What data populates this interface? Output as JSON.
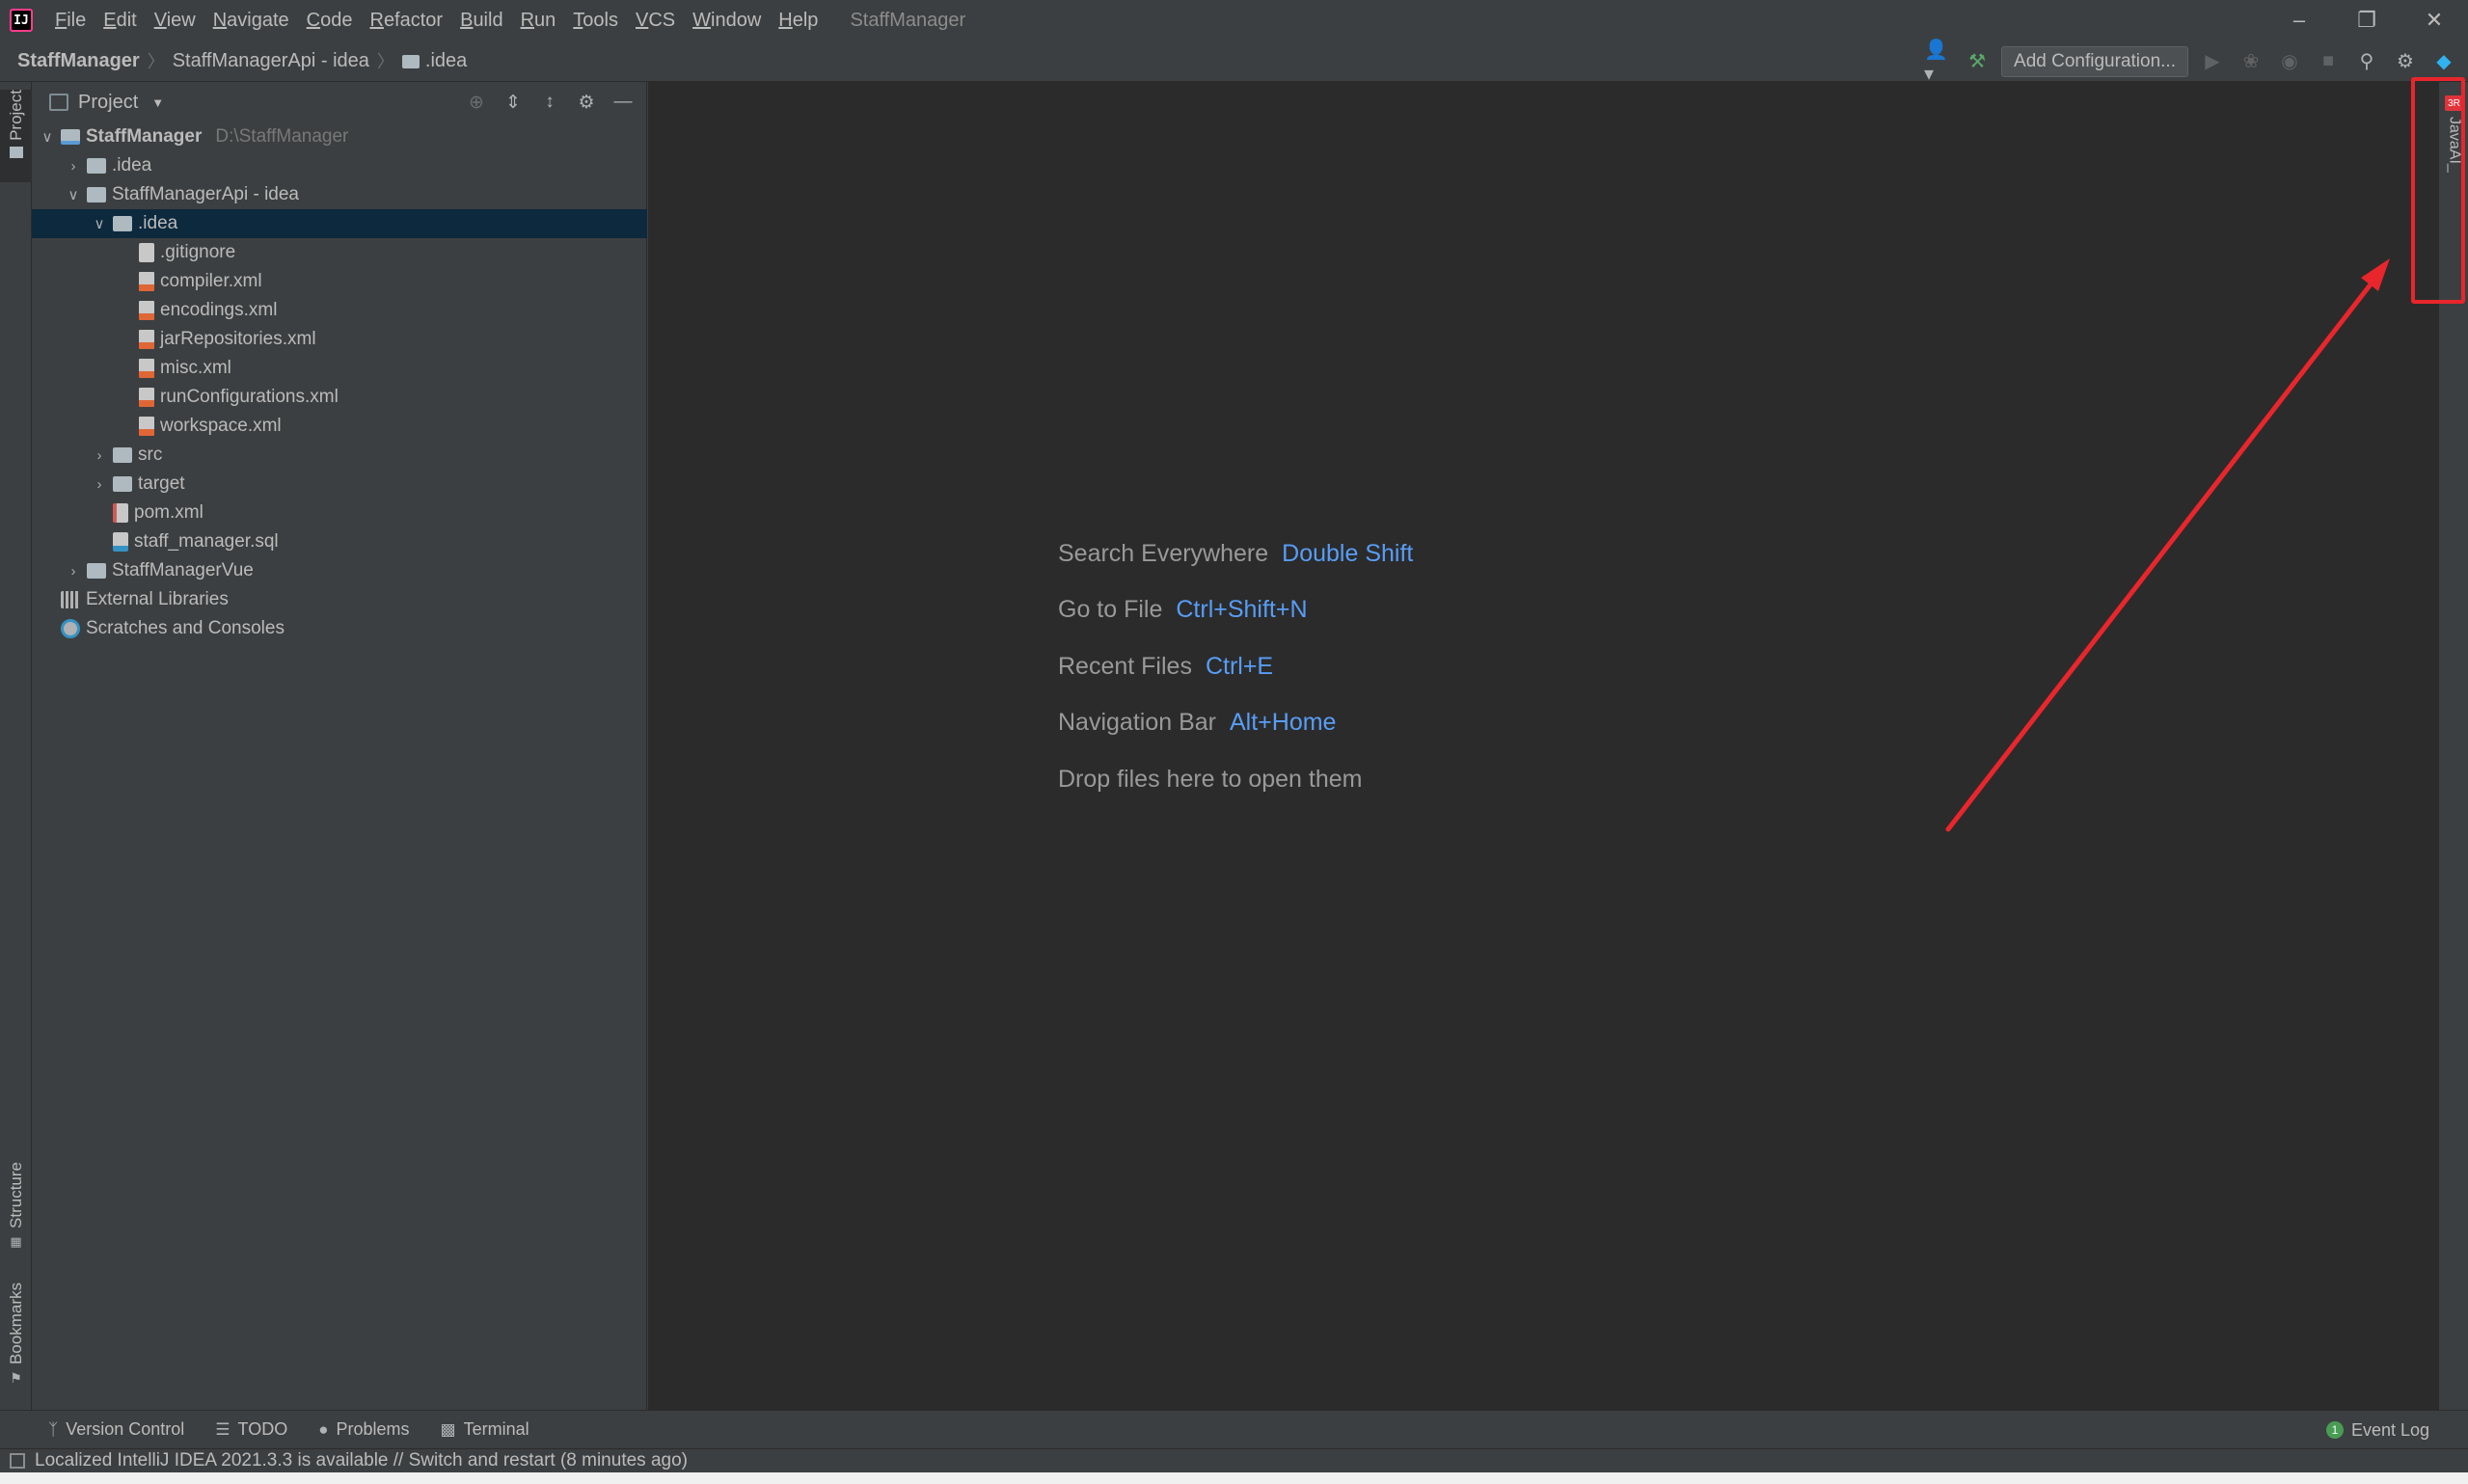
{
  "titlebar": {
    "app_icon_text": "IJ",
    "menu": [
      {
        "label": "File",
        "mnemonic": "F",
        "rest": "ile"
      },
      {
        "label": "Edit",
        "mnemonic": "E",
        "rest": "dit"
      },
      {
        "label": "View",
        "mnemonic": "V",
        "rest": "iew"
      },
      {
        "label": "Navigate",
        "mnemonic": "N",
        "rest": "avigate"
      },
      {
        "label": "Code",
        "mnemonic": "C",
        "rest": "ode"
      },
      {
        "label": "Refactor",
        "mnemonic": "R",
        "rest": "efactor"
      },
      {
        "label": "Build",
        "mnemonic": "B",
        "rest": "uild"
      },
      {
        "label": "Run",
        "mnemonic": "R",
        "rest": "un"
      },
      {
        "label": "Tools",
        "mnemonic": "T",
        "rest": "ools"
      },
      {
        "label": "VCS",
        "mnemonic": "V",
        "rest": "CS"
      },
      {
        "label": "Window",
        "mnemonic": "W",
        "rest": "indow"
      },
      {
        "label": "Help",
        "mnemonic": "H",
        "rest": "elp"
      }
    ],
    "window_title": "StaffManager",
    "controls": {
      "minimize": "–",
      "restore": "❐",
      "close": "✕"
    }
  },
  "navbar": {
    "breadcrumbs": [
      "StaffManager",
      "StaffManagerApi - idea",
      ".idea"
    ],
    "add_configuration": "Add Configuration..."
  },
  "left_stripe": {
    "project_tab": "Project",
    "structure_tab": "Structure",
    "bookmarks_tab": "Bookmarks"
  },
  "project_panel": {
    "title": "Project",
    "tree": [
      {
        "label": "StaffManager",
        "path": "D:\\StaffManager"
      },
      {
        "label": ".idea"
      },
      {
        "label": "StaffManagerApi - idea"
      },
      {
        "label": ".idea"
      },
      {
        "label": ".gitignore"
      },
      {
        "label": "compiler.xml"
      },
      {
        "label": "encodings.xml"
      },
      {
        "label": "jarRepositories.xml"
      },
      {
        "label": "misc.xml"
      },
      {
        "label": "runConfigurations.xml"
      },
      {
        "label": "workspace.xml"
      },
      {
        "label": "src"
      },
      {
        "label": "target"
      },
      {
        "label": "pom.xml"
      },
      {
        "label": "staff_manager.sql"
      },
      {
        "label": "StaffManagerVue"
      },
      {
        "label": "External Libraries"
      },
      {
        "label": "Scratches and Consoles"
      }
    ]
  },
  "editor": {
    "hints": [
      {
        "text": "Search Everywhere",
        "key": "Double Shift"
      },
      {
        "text": "Go to File",
        "key": "Ctrl+Shift+N"
      },
      {
        "text": "Recent Files",
        "key": "Ctrl+E"
      },
      {
        "text": "Navigation Bar",
        "key": "Alt+Home"
      },
      {
        "text": "Drop files here to open them",
        "key": ""
      }
    ]
  },
  "right_stripe": {
    "javaai_badge": "3R",
    "javaai_tab": "JavaAI_"
  },
  "tool_bar": {
    "tabs": [
      "Version Control",
      "TODO",
      "Problems",
      "Terminal"
    ],
    "event_log": "Event Log",
    "event_count": "1"
  },
  "status_bar": {
    "message": "Localized IntelliJ IDEA 2021.3.3 is available // Switch and restart (8 minutes ago)"
  },
  "colors": {
    "background": "#2b2b2b",
    "panel": "#3c3f41",
    "selection": "#0d293e",
    "shortcut": "#589df6",
    "annotation": "#e8262c"
  }
}
